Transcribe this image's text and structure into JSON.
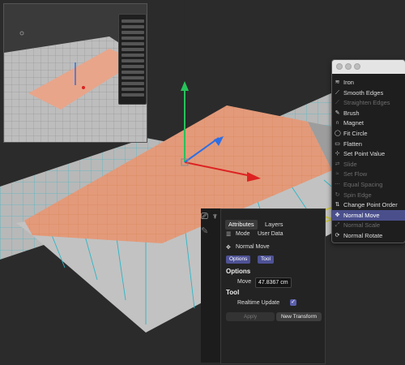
{
  "menu": {
    "items": [
      {
        "label": "Iron",
        "icon": "iron-icon",
        "glyph": "≋",
        "disabled": false,
        "selected": false
      },
      {
        "label": "Smooth Edges",
        "icon": "smooth-edges-icon",
        "glyph": "⟋",
        "disabled": false,
        "selected": false
      },
      {
        "label": "Straighten Edges",
        "icon": "straighten-edges-icon",
        "glyph": "⟋",
        "disabled": true,
        "selected": false
      },
      {
        "label": "Brush",
        "icon": "brush-icon",
        "glyph": "✎",
        "disabled": false,
        "selected": false
      },
      {
        "label": "Magnet",
        "icon": "magnet-icon",
        "glyph": "∩",
        "disabled": false,
        "selected": false
      },
      {
        "label": "Fit Circle",
        "icon": "fit-circle-icon",
        "glyph": "◯",
        "disabled": false,
        "selected": false
      },
      {
        "label": "Flatten",
        "icon": "flatten-icon",
        "glyph": "▭",
        "disabled": false,
        "selected": false
      },
      {
        "label": "Set Point Value",
        "icon": "set-point-value-icon",
        "glyph": "⊹",
        "disabled": false,
        "selected": false
      },
      {
        "label": "Slide",
        "icon": "slide-icon",
        "glyph": "⇄",
        "disabled": true,
        "selected": false
      },
      {
        "label": "Set Flow",
        "icon": "set-flow-icon",
        "glyph": "≈",
        "disabled": true,
        "selected": false
      },
      {
        "label": "Equal Spacing",
        "icon": "equal-spacing-icon",
        "glyph": "⋯",
        "disabled": true,
        "selected": false
      },
      {
        "label": "Spin Edge",
        "icon": "spin-edge-icon",
        "glyph": "↻",
        "disabled": true,
        "selected": false
      },
      {
        "label": "Change Point Order",
        "icon": "change-point-order-icon",
        "glyph": "⇅",
        "disabled": false,
        "selected": false
      },
      {
        "label": "Normal Move",
        "icon": "normal-move-icon",
        "glyph": "✥",
        "disabled": false,
        "selected": true
      },
      {
        "label": "Normal Scale",
        "icon": "normal-scale-icon",
        "glyph": "⤢",
        "disabled": true,
        "selected": false
      },
      {
        "label": "Normal Rotate",
        "icon": "normal-rotate-icon",
        "glyph": "⟳",
        "disabled": false,
        "selected": false
      }
    ]
  },
  "attributes": {
    "tabs": [
      "Attributes",
      "Layers"
    ],
    "mode_label": "Mode",
    "userdata_label": "User Data",
    "tool_name": "Normal Move",
    "subtabs": [
      "Options",
      "Tool"
    ],
    "options_header": "Options",
    "move_label": "Move",
    "move_value": "47.8367 cm",
    "tool_header": "Tool",
    "realtime_label": "Realtime Update",
    "realtime_checked": true,
    "apply_label": "Apply",
    "new_transform_label": "New Transform"
  },
  "colors": {
    "selection": "#e39a7a",
    "accent": "#4e5296",
    "annotation": "#c8c24a"
  }
}
